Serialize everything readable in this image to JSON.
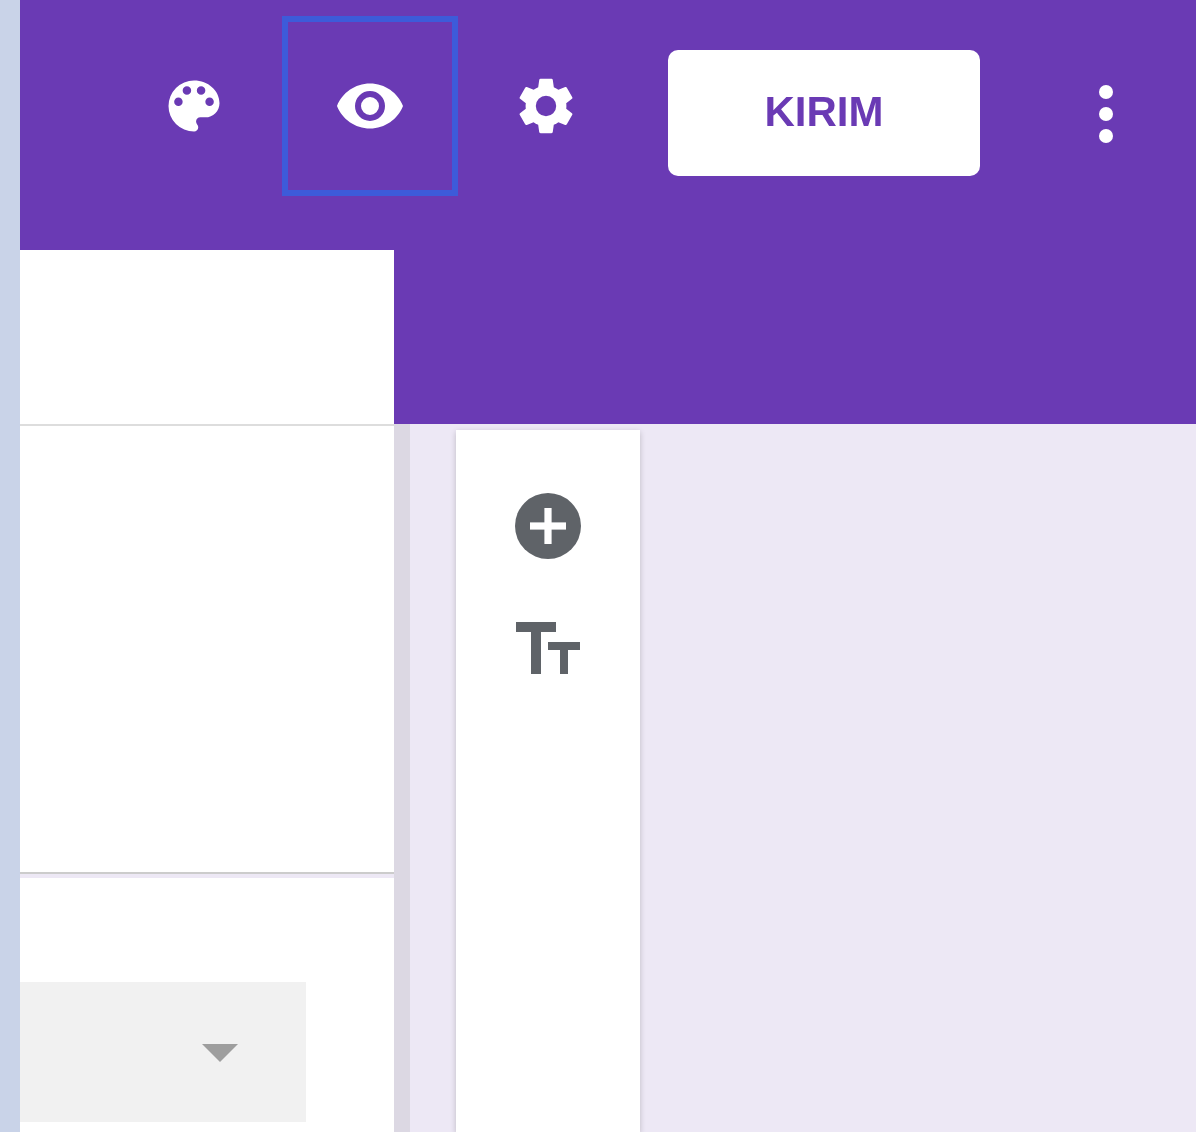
{
  "header": {
    "icon_buttons": [
      {
        "kind": "palette",
        "focused": false
      },
      {
        "kind": "preview",
        "focused": true
      },
      {
        "kind": "settings",
        "focused": false
      }
    ],
    "send_button": "KIRIM"
  },
  "toolbar": [
    {
      "kind": "add"
    },
    {
      "kind": "title"
    }
  ]
}
